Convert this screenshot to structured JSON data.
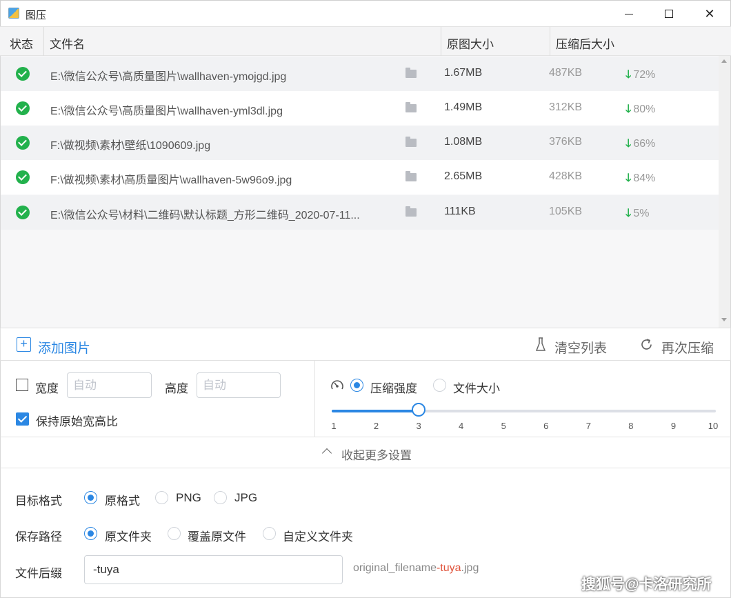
{
  "window": {
    "title": "图压"
  },
  "table": {
    "headers": {
      "status": "状态",
      "filename": "文件名",
      "original_size": "原图大小",
      "compressed_size": "压缩后大小"
    },
    "rows": [
      {
        "path": "E:\\微信公众号\\高质量图片\\wallhaven-ymojgd.jpg",
        "original": "1.67MB",
        "compressed": "487KB",
        "ratio": "72%"
      },
      {
        "path": "E:\\微信公众号\\高质量图片\\wallhaven-yml3dl.jpg",
        "original": "1.49MB",
        "compressed": "312KB",
        "ratio": "80%"
      },
      {
        "path": "F:\\做视频\\素材\\壁纸\\1090609.jpg",
        "original": "1.08MB",
        "compressed": "376KB",
        "ratio": "66%"
      },
      {
        "path": "F:\\做视频\\素材\\高质量图片\\wallhaven-5w96o9.jpg",
        "original": "2.65MB",
        "compressed": "428KB",
        "ratio": "84%"
      },
      {
        "path": "E:\\微信公众号\\材料\\二维码\\默认标题_方形二维码_2020-07-11...",
        "original": "111KB",
        "compressed": "105KB",
        "ratio": "5%"
      }
    ]
  },
  "toolbar": {
    "add_label": "添加图片",
    "clear_label": "清空列表",
    "recompress_label": "再次压缩"
  },
  "size": {
    "width_label": "宽度",
    "width_placeholder": "自动",
    "height_label": "高度",
    "height_placeholder": "自动",
    "keep_ratio_label": "保持原始宽高比",
    "keep_ratio_checked": true
  },
  "compression": {
    "mode_strength_label": "压缩强度",
    "mode_filesize_label": "文件大小",
    "selected_mode": "strength",
    "slider_value": 3,
    "slider_min": 1,
    "slider_max": 10,
    "ticks": [
      "1",
      "2",
      "3",
      "4",
      "5",
      "6",
      "7",
      "8",
      "9",
      "10"
    ]
  },
  "collapse_label": "收起更多设置",
  "format": {
    "label": "目标格式",
    "options": [
      "原格式",
      "PNG",
      "JPG"
    ],
    "selected": 0
  },
  "save_path": {
    "label": "保存路径",
    "options": [
      "原文件夹",
      "覆盖原文件",
      "自定义文件夹"
    ],
    "selected": 0
  },
  "suffix": {
    "label": "文件后缀",
    "value": "-tuya",
    "preview_prefix": "original_filename",
    "preview_suffix": "-tuya",
    "preview_ext": ".jpg"
  },
  "watermark": "搜狐号@卡洛研究所",
  "colors": {
    "accent": "#2b87e3",
    "success": "#22b14c",
    "highlight": "#e0533b"
  }
}
